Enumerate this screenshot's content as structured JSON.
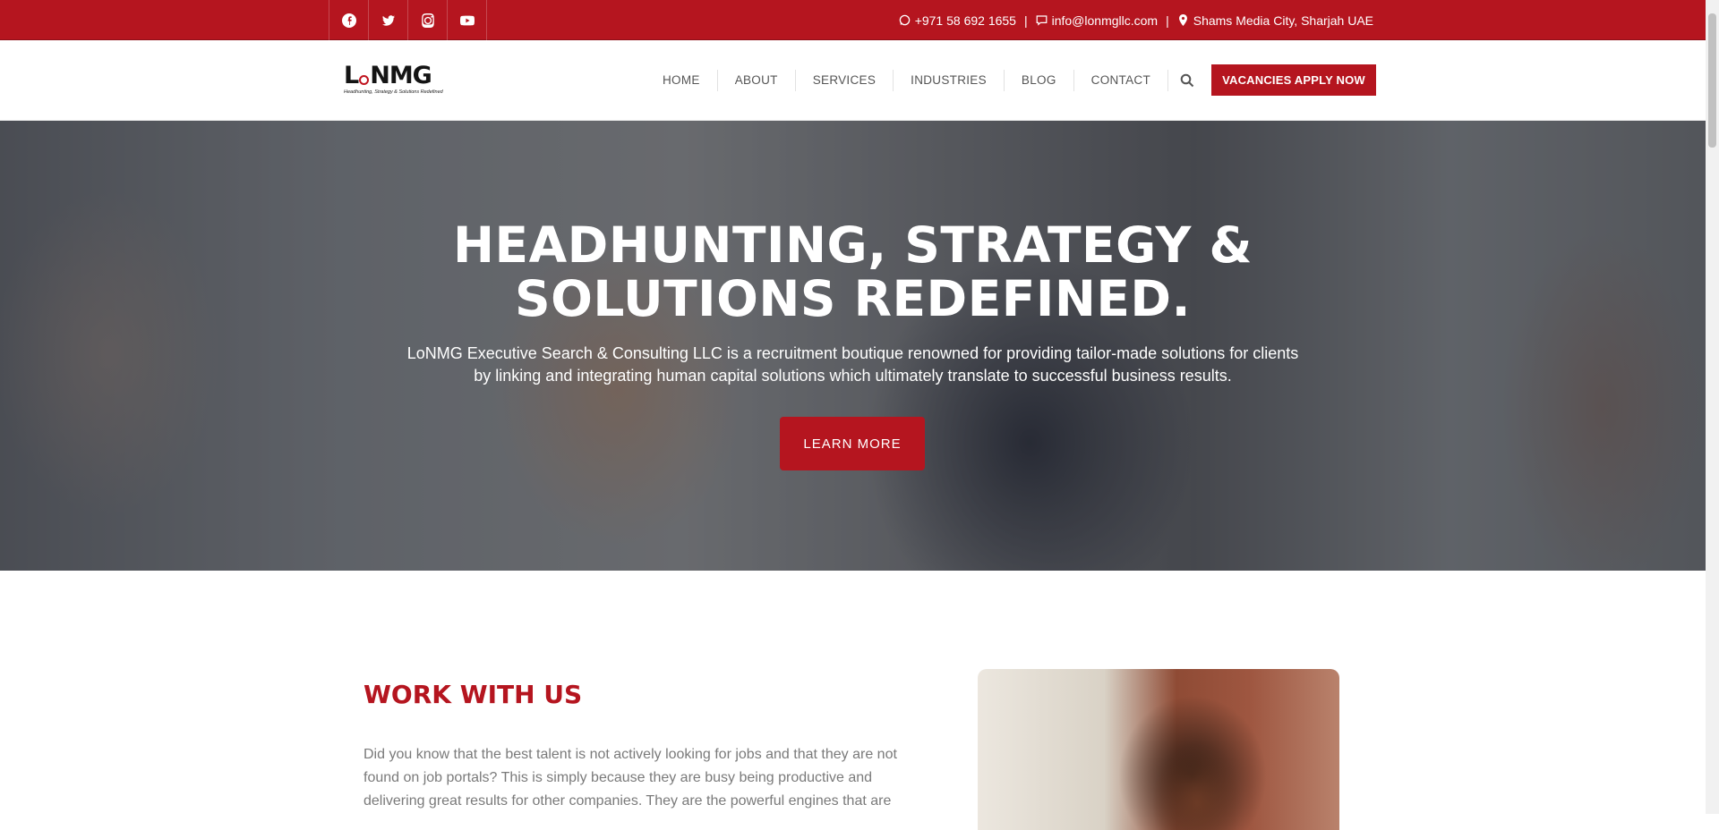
{
  "topbar": {
    "social": [
      {
        "icon": "facebook-icon"
      },
      {
        "icon": "twitter-icon"
      },
      {
        "icon": "instagram-icon"
      },
      {
        "icon": "youtube-icon"
      }
    ],
    "phone": "+971 58 692 1655",
    "email": "info@lonmgllc.com",
    "location": "Shams Media City, Sharjah UAE",
    "separator": "|"
  },
  "header": {
    "logo_text_left": "L",
    "logo_text_right": "NMG",
    "logo_tagline": "Headhunting, Strategy & Solutions Redefined",
    "nav": [
      "HOME",
      "ABOUT",
      "SERVICES",
      "INDUSTRIES",
      "BLOG",
      "CONTACT"
    ],
    "cta": "VACANCIES APPLY NOW"
  },
  "hero": {
    "title_line1": "HEADHUNTING, STRATEGY &",
    "title_line2": "SOLUTIONS REDEFINED.",
    "description": "LoNMG Executive Search & Consulting LLC is a recruitment boutique renowned for providing tailor-made solutions for clients by linking and integrating human capital solutions which ultimately translate to successful business results.",
    "button": "LEARN MORE"
  },
  "work": {
    "title": "WORK WITH US",
    "text": "Did you know that the best talent is not actively looking for jobs and that they are not found on job portals? This is simply because they are busy being productive and delivering great results for other companies. They are the powerful engines that are"
  },
  "colors": {
    "brand_red": "#b5151f",
    "text_gray": "#7a7a7a"
  }
}
